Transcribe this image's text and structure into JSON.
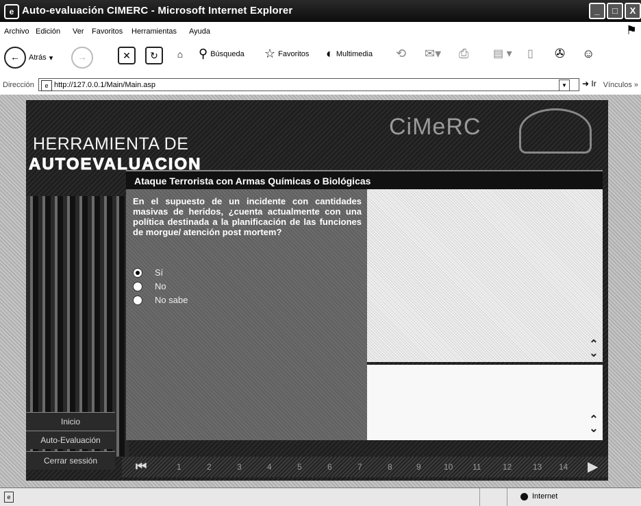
{
  "window": {
    "title": "Auto-evaluación CIMERC - Microsoft Internet Explorer",
    "minimize": "_",
    "maximize": "□",
    "close": "X"
  },
  "menu": [
    "Archivo",
    "Edición",
    "Ver",
    "Favoritos",
    "Herramientas",
    "Ayuda"
  ],
  "toolbar": {
    "back": "Atrás",
    "search": "Búsqueda",
    "favorites": "Favoritos",
    "multimedia": "Multimedia"
  },
  "address": {
    "label": "Dirección",
    "url": "http://127.0.0.1/Main/Main.asp",
    "go": "Ir",
    "links": "Vínculos »"
  },
  "page": {
    "title_line1": "HERRAMIENTA DE",
    "title_line2": "AUTOEVALUACION",
    "logo": "CiMeRC",
    "nav": [
      "Inicio",
      "Auto-Evaluación",
      "Cerrar sessión"
    ],
    "question_header": "Ataque Terrorista con Armas Químicas o Biológicas",
    "question_text": "En el supuesto de un incidente con cantidades masivas de heridos, ¿cuenta actualmente con una política destinada a la planificación de las funciones de morgue/ atención post mortem?",
    "options": [
      "Sí",
      "No",
      "No sabe"
    ],
    "selected_option": 0,
    "pages": [
      "1",
      "2",
      "3",
      "4",
      "5",
      "6",
      "7",
      "8",
      "9",
      "10",
      "11",
      "12",
      "13",
      "14"
    ]
  },
  "status": {
    "zone": "Internet"
  }
}
